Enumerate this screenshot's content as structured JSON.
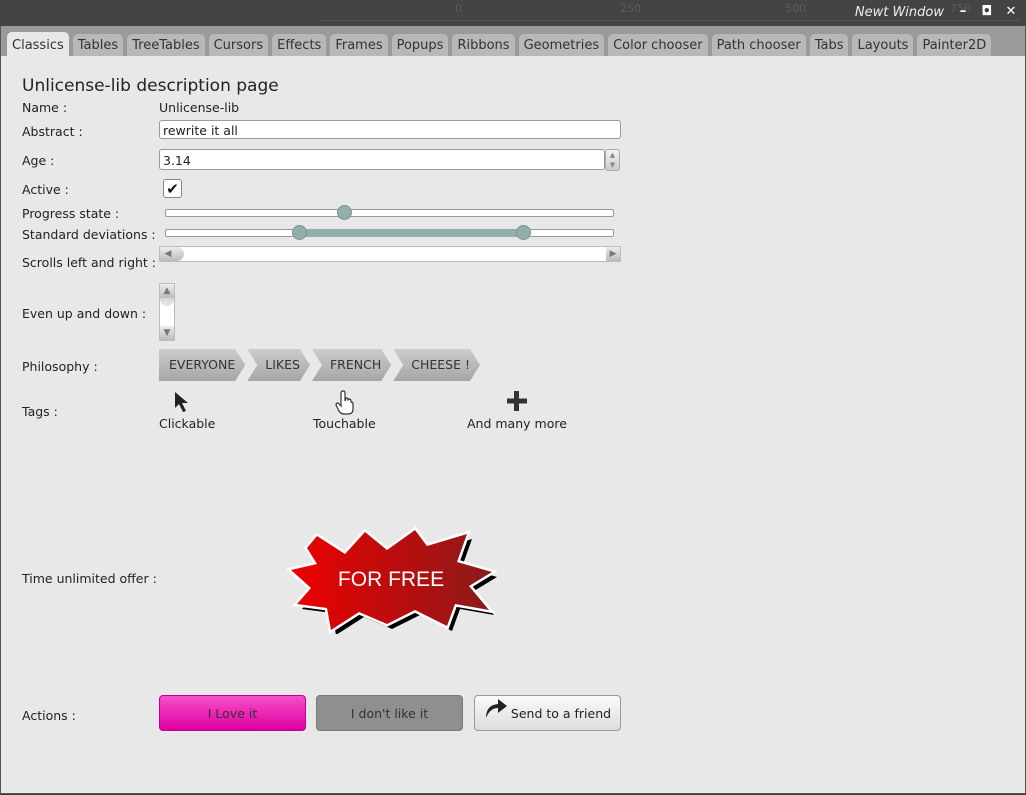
{
  "window": {
    "title": "Newt Window",
    "controls": [
      "minimize",
      "maximize",
      "close"
    ],
    "background_ruler_labels": [
      "0",
      "250",
      "500",
      "750"
    ]
  },
  "tabs": [
    {
      "label": "Classics",
      "active": true
    },
    {
      "label": "Tables"
    },
    {
      "label": "TreeTables"
    },
    {
      "label": "Cursors"
    },
    {
      "label": "Effects"
    },
    {
      "label": "Frames"
    },
    {
      "label": "Popups"
    },
    {
      "label": "Ribbons"
    },
    {
      "label": "Geometries"
    },
    {
      "label": "Color chooser"
    },
    {
      "label": "Path chooser"
    },
    {
      "label": "Tabs"
    },
    {
      "label": "Layouts"
    },
    {
      "label": "Painter2D"
    }
  ],
  "page": {
    "heading": "Unlicense-lib description page",
    "name": {
      "label": "Name :",
      "value": "Unlicense-lib"
    },
    "abstract": {
      "label": "Abstract :",
      "value": "rewrite it all"
    },
    "age": {
      "label": "Age :",
      "value": "3.14"
    },
    "active": {
      "label": "Active :",
      "checked": true
    },
    "progress": {
      "label": "Progress state :",
      "value": 0.4
    },
    "deviations": {
      "label": "Standard deviations :",
      "low": 0.3,
      "high": 0.8
    },
    "hscroll": {
      "label": "Scrolls left and right :",
      "value": 0
    },
    "vscroll": {
      "label": "Even up and down :",
      "value": 0
    },
    "philosophy": {
      "label": "Philosophy :",
      "items": [
        "EVERYONE",
        "LIKES",
        "FRENCH",
        "CHEESE !"
      ]
    },
    "tags": {
      "label": "Tags :",
      "items": [
        {
          "label": "Clickable",
          "icon": "arrow-cursor-icon"
        },
        {
          "label": "Touchable",
          "icon": "hand-cursor-icon"
        },
        {
          "label": "And many more",
          "icon": "plus-icon"
        }
      ]
    },
    "offer": {
      "label": "Time unlimited offer :",
      "text": "FOR FREE",
      "colors": [
        "#ee0000",
        "#8b1a1a"
      ]
    },
    "actions": {
      "label": "Actions :",
      "love": "I Love it",
      "dislike": "I don't like it",
      "send": "Send to a friend"
    }
  }
}
